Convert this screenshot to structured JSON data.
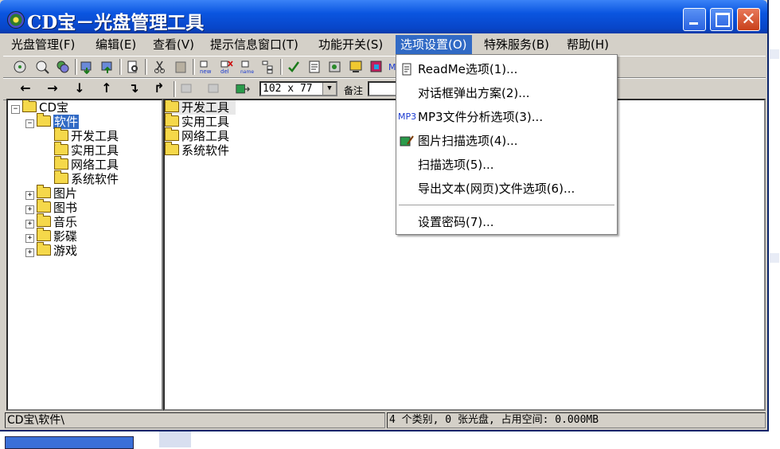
{
  "window": {
    "title": "CD宝－光盘管理工具"
  },
  "menubar": [
    {
      "label": "光盘管理",
      "key": "(F)"
    },
    {
      "label": "编辑",
      "key": "(E)"
    },
    {
      "label": "查看",
      "key": "(V)"
    },
    {
      "label": "提示信息窗口",
      "key": "(T)"
    },
    {
      "label": "功能开关",
      "key": "(S)"
    },
    {
      "label": "选项设置",
      "key": "(O)"
    },
    {
      "label": "特殊服务",
      "key": "(B)"
    },
    {
      "label": "帮助",
      "key": "(H)"
    }
  ],
  "toolbar2": {
    "size_value": "102 x 77",
    "memo_label": "备注"
  },
  "tree": {
    "root": "CD宝",
    "selected": "软件",
    "children_of_selected": [
      "开发工具",
      "实用工具",
      "网络工具",
      "系统软件"
    ],
    "other": [
      "图片",
      "图书",
      "音乐",
      "影碟",
      "游戏"
    ]
  },
  "list": {
    "items": [
      "开发工具",
      "实用工具",
      "网络工具",
      "系统软件"
    ]
  },
  "status": {
    "path": "CD宝\\软件\\",
    "summary": "4 个类别, 0 张光盘, 占用空间: 0.000MB"
  },
  "dropdown": {
    "items": [
      {
        "label": "ReadMe选项(1)...",
        "icon": "readme-icon"
      },
      {
        "label": "对话框弹出方案(2)...",
        "icon": ""
      },
      {
        "label": "MP3文件分析选项(3)...",
        "icon": "mp3-icon"
      },
      {
        "label": "图片扫描选项(4)...",
        "icon": "picture-scan-icon"
      },
      {
        "label": "扫描选项(5)...",
        "icon": ""
      },
      {
        "label": "导出文本(网页)文件选项(6)...",
        "icon": ""
      },
      {
        "label": "设置密码(7)...",
        "icon": ""
      }
    ],
    "mp3_text": "MP3"
  }
}
